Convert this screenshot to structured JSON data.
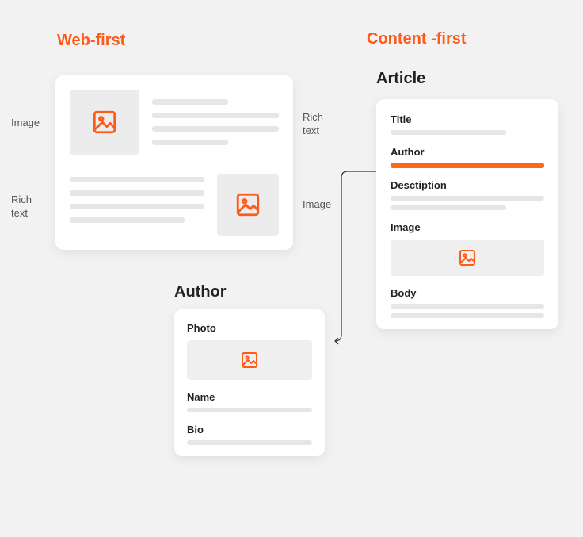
{
  "headings": {
    "web_first": "Web-first",
    "content_first": "Content -first",
    "article": "Article",
    "author": "Author"
  },
  "side_labels": {
    "image_top": "Image",
    "rich_text_top": "Rich\ntext",
    "rich_text_bottom": "Rich\ntext",
    "image_bottom": "Image"
  },
  "article_fields": {
    "title": "Title",
    "author": "Author",
    "description": "Desctiption",
    "image": "Image",
    "body": "Body"
  },
  "author_fields": {
    "photo": "Photo",
    "name": "Name",
    "bio": "Bio"
  },
  "colors": {
    "accent": "#ff5a1a",
    "placeholder": "#e6e6e6"
  }
}
